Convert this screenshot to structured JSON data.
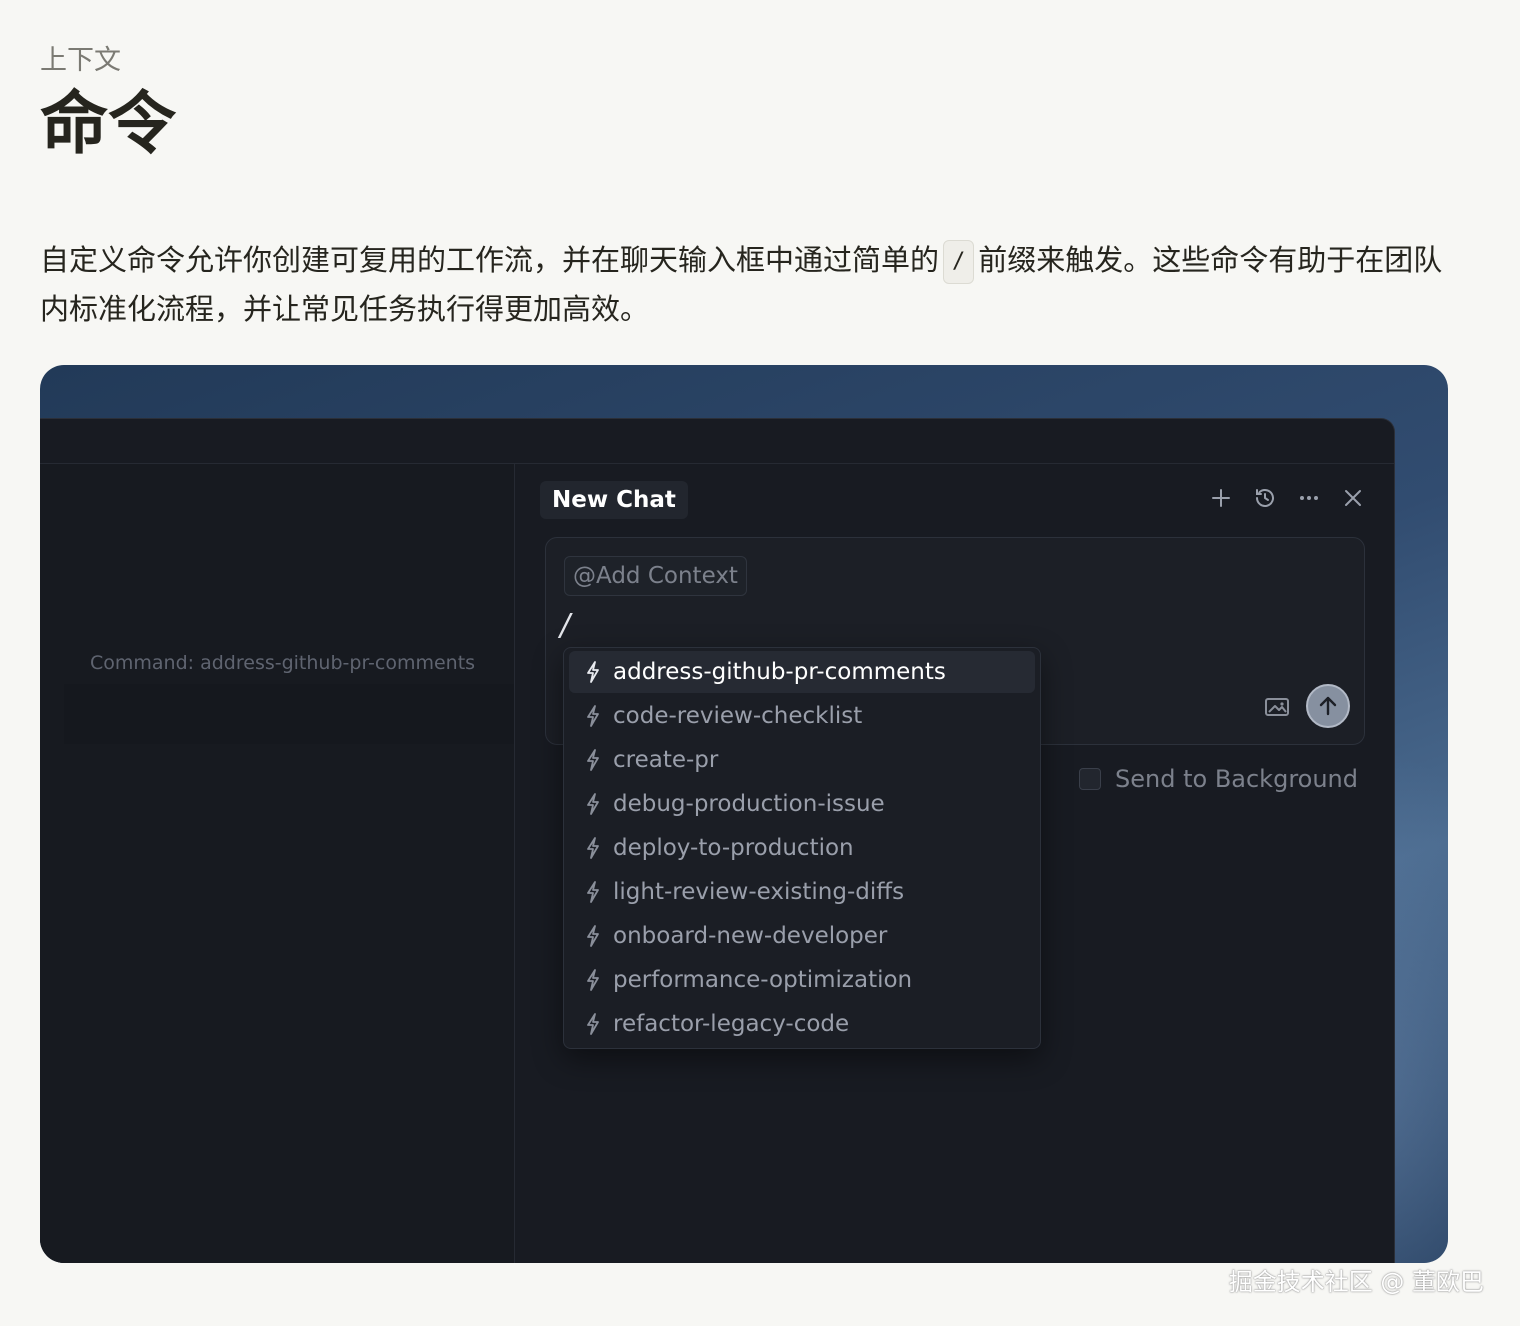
{
  "breadcrumb": "上下文",
  "page_title": "命令",
  "intro": {
    "part1": "自定义命令允许你创建可复用的工作流，并在聊天输入框中通过简单的",
    "code": "/",
    "part2": "前缀来触发。这些命令有助于在团队内标准化流程，并让常见任务执行得更加高效。"
  },
  "editor": {
    "command_hint": "Command: address-github-pr-comments"
  },
  "chat": {
    "tab_label": "New Chat",
    "toolbar_icons": [
      "plus-icon",
      "history-icon",
      "more-icon",
      "close-icon"
    ],
    "add_context_label": "@Add Context",
    "input_value": "/",
    "send_to_background_label": "Send to Background",
    "commands": [
      "address-github-pr-comments",
      "code-review-checklist",
      "create-pr",
      "debug-production-issue",
      "deploy-to-production",
      "light-review-existing-diffs",
      "onboard-new-developer",
      "performance-optimization",
      "refactor-legacy-code"
    ],
    "selected_command": "address-github-pr-comments"
  },
  "watermark": "掘金技术社区 @ 董欧巴",
  "colors": {
    "page_bg": "#f7f7f4",
    "window_bg": "#181b22",
    "accent_send": "#8690a0"
  }
}
